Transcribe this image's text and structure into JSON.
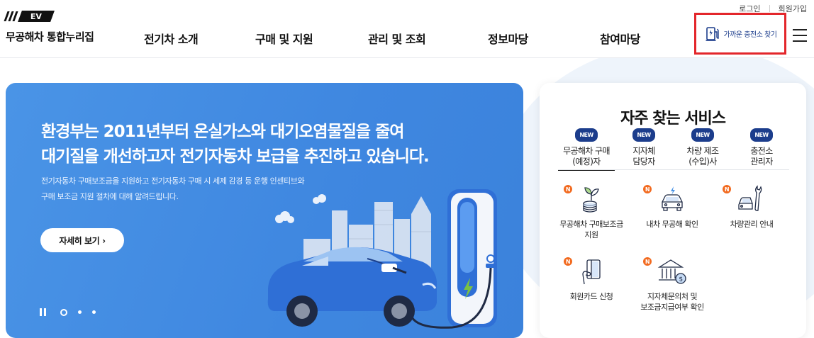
{
  "header": {
    "util": {
      "login": "로그인",
      "signup": "회원가입"
    },
    "logo": {
      "mark_text": "EV",
      "title": "무공해차 통합누리집"
    },
    "nav": [
      "전기차 소개",
      "구매 및 지원",
      "관리 및 조회",
      "정보마당",
      "참여마당"
    ],
    "charge_btn_label": "가까운 충전소 찾기",
    "highlight_color": "#e3262b"
  },
  "hero": {
    "title_line1": "환경부는 2011년부터 온실가스와 대기오염물질을 줄여",
    "title_line2": "대기질을 개선하고자 전기자동차 보급을 추진하고 있습니다.",
    "desc_line1": "전기자동차 구매보조금을 지원하고 전기자동차 구매 시 세제 감경 등 운행 인센티브와",
    "desc_line2": "구매 보조금 지원 절차에 대해 알려드립니다.",
    "button_label": "자세히 보기 ›",
    "bg_color": "#4a94e6"
  },
  "services": {
    "title": "자주 찾는 서비스",
    "tabs": [
      {
        "badge": "NEW",
        "line1": "무공해차 구매",
        "line2": "(예정)자",
        "active": true
      },
      {
        "badge": "NEW",
        "line1": "지자체",
        "line2": "담당자",
        "active": false
      },
      {
        "badge": "NEW",
        "line1": "차량 제조",
        "line2": "(수입)사",
        "active": false
      },
      {
        "badge": "NEW",
        "line1": "충전소",
        "line2": "관리자",
        "active": false
      }
    ],
    "items": [
      {
        "badge": "N",
        "icon": "coin-plant-icon",
        "line1": "무공해차 구매보조금",
        "line2": "지원"
      },
      {
        "badge": "N",
        "icon": "car-icon",
        "line1": "내차 무공해 확인",
        "line2": ""
      },
      {
        "badge": "N",
        "icon": "car-wrench-icon",
        "line1": "차량관리 안내",
        "line2": ""
      },
      {
        "badge": "N",
        "icon": "card-hand-icon",
        "line1": "회원카드 신청",
        "line2": ""
      },
      {
        "badge": "N",
        "icon": "bank-icon",
        "line1": "지자체문의처 및",
        "line2": "보조금지급여부 확인"
      }
    ],
    "badge_color": "#1c3d8c",
    "n_color": "#f26a1f"
  }
}
